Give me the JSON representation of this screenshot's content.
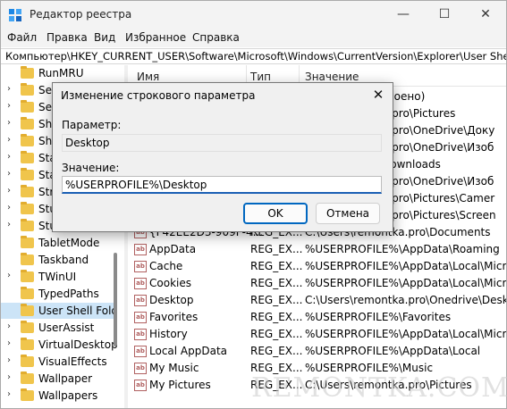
{
  "window": {
    "title": "Редактор реестра",
    "controls": {
      "minimize": "—",
      "maximize": "☐",
      "close": "✕"
    }
  },
  "menu": [
    "Файл",
    "Правка",
    "Вид",
    "Избранное",
    "Справка"
  ],
  "address": "Компьютер\\HKEY_CURRENT_USER\\Software\\Microsoft\\Windows\\CurrentVersion\\Explorer\\User Shell Folders",
  "tree": {
    "items": [
      {
        "label": "RunMRU",
        "expandable": false,
        "selected": false
      },
      {
        "label": "Sea",
        "expandable": true,
        "selected": false
      },
      {
        "label": "Ses",
        "expandable": true,
        "selected": false
      },
      {
        "label": "Shu",
        "expandable": true,
        "selected": false
      },
      {
        "label": "Shu",
        "expandable": true,
        "selected": false
      },
      {
        "label": "Sta",
        "expandable": true,
        "selected": false
      },
      {
        "label": "Sta",
        "expandable": true,
        "selected": false
      },
      {
        "label": "Str",
        "expandable": true,
        "selected": false
      },
      {
        "label": "Stu",
        "expandable": true,
        "selected": false
      },
      {
        "label": "Stu",
        "expandable": true,
        "selected": false
      },
      {
        "label": "TabletMode",
        "expandable": false,
        "selected": false
      },
      {
        "label": "Taskband",
        "expandable": false,
        "selected": false
      },
      {
        "label": "TWinUI",
        "expandable": true,
        "selected": false
      },
      {
        "label": "TypedPaths",
        "expandable": false,
        "selected": false
      },
      {
        "label": "User Shell Fold",
        "expandable": false,
        "selected": true
      },
      {
        "label": "UserAssist",
        "expandable": true,
        "selected": false
      },
      {
        "label": "VirtualDesktop",
        "expandable": true,
        "selected": false
      },
      {
        "label": "VisualEffects",
        "expandable": true,
        "selected": false
      },
      {
        "label": "Wallpaper",
        "expandable": true,
        "selected": false
      },
      {
        "label": "Wallpapers",
        "expandable": true,
        "selected": false
      }
    ]
  },
  "list": {
    "columns": {
      "name": "Имя",
      "type": "Тип",
      "value": "Значение"
    },
    "background_values": [
      "своено)",
      "a.pro\\Pictures",
      "a.pro\\OneDrive\\Доку",
      "a.pro\\OneDrive\\Изоб",
      "Downloads",
      "a.pro\\OneDrive\\Изоб",
      "a.pro\\Pictures\\Camer",
      "a.pro\\Pictures\\Screen"
    ],
    "rows": [
      {
        "name": "{F42EE2D3-909F-4...",
        "type": "REG_EX...",
        "value": "C:\\Users\\remontka.pro\\Documents",
        "icon": "ab"
      },
      {
        "name": "AppData",
        "type": "REG_EX...",
        "value": "%USERPROFILE%\\AppData\\Roaming",
        "icon": "ab"
      },
      {
        "name": "Cache",
        "type": "REG_EX...",
        "value": "%USERPROFILE%\\AppData\\Local\\Micro",
        "icon": "ab"
      },
      {
        "name": "Cookies",
        "type": "REG_EX...",
        "value": "%USERPROFILE%\\AppData\\Local\\Micro",
        "icon": "ab"
      },
      {
        "name": "Desktop",
        "type": "REG_EX...",
        "value": "C:\\Users\\remontka.pro\\Onedrive\\Deskt",
        "icon": "ab"
      },
      {
        "name": "Favorites",
        "type": "REG_EX...",
        "value": "%USERPROFILE%\\Favorites",
        "icon": "ab"
      },
      {
        "name": "History",
        "type": "REG_EX...",
        "value": "%USERPROFILE%\\AppData\\Local\\Micro",
        "icon": "ab"
      },
      {
        "name": "Local AppData",
        "type": "REG_EX...",
        "value": "%USERPROFILE%\\AppData\\Local",
        "icon": "ab"
      },
      {
        "name": "My Music",
        "type": "REG_EX...",
        "value": "%USERPROFILE%\\Music",
        "icon": "ab"
      },
      {
        "name": "My Pictures",
        "type": "REG_EX...",
        "value": "C:\\Users\\remontka.pro\\Pictures",
        "icon": "ab"
      }
    ]
  },
  "dialog": {
    "title": "Изменение строкового параметра",
    "close": "✕",
    "param_label": "Параметр:",
    "param_value": "Desktop",
    "value_label": "Значение:",
    "value_value": "%USERPROFILE%\\Desktop",
    "ok_label": "OK",
    "cancel_label": "Отмена"
  },
  "watermark": "REMONTKA.COM"
}
